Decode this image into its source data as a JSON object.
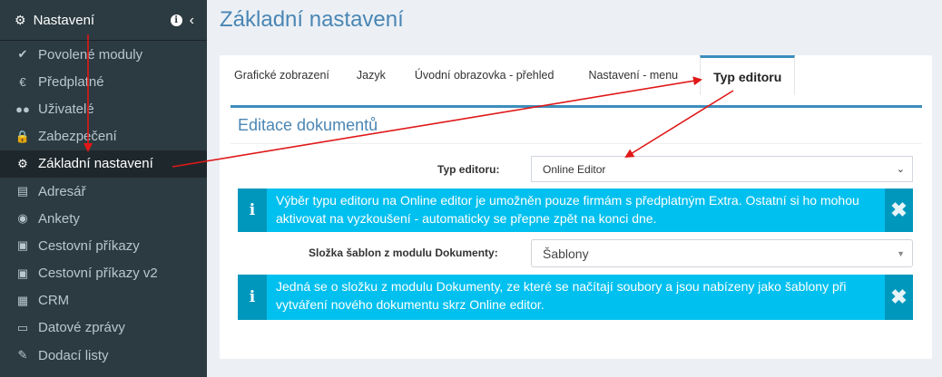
{
  "sidebar": {
    "header_label": "Nastavení",
    "info_symbol": "i",
    "collapse_symbol": "‹",
    "items": [
      {
        "label": "Povolené moduly",
        "icon": "✔",
        "icon_name": "check-icon"
      },
      {
        "label": "Předplatné",
        "icon": "€",
        "icon_name": "euro-icon"
      },
      {
        "label": "Uživatelé",
        "icon": "●●",
        "icon_name": "users-icon"
      },
      {
        "label": "Zabezpečení",
        "icon": "🔒",
        "icon_name": "lock-icon"
      },
      {
        "label": "Základní nastavení",
        "icon": "⚙",
        "icon_name": "cogs-icon",
        "active": true
      },
      {
        "label": "Adresář",
        "icon": "▤",
        "icon_name": "book-icon"
      },
      {
        "label": "Ankety",
        "icon": "◉",
        "icon_name": "bullseye-icon"
      },
      {
        "label": "Cestovní příkazy",
        "icon": "▣",
        "icon_name": "train-icon"
      },
      {
        "label": "Cestovní příkazy v2",
        "icon": "▣",
        "icon_name": "train-icon"
      },
      {
        "label": "CRM",
        "icon": "▦",
        "icon_name": "building-icon"
      },
      {
        "label": "Datové zprávy",
        "icon": "▭",
        "icon_name": "inbox-icon"
      },
      {
        "label": "Dodací listy",
        "icon": "✎",
        "icon_name": "edit-icon"
      }
    ]
  },
  "page": {
    "title": "Základní nastavení"
  },
  "tabs": [
    {
      "label": "Grafické zobrazení"
    },
    {
      "label": "Jazyk"
    },
    {
      "label": "Úvodní obrazovka - přehled"
    },
    {
      "label": "Nastavení - menu"
    },
    {
      "label": "Typ editoru",
      "active": true
    }
  ],
  "panel": {
    "title": "Editace dokumentů",
    "editor_label": "Typ editoru:",
    "editor_value": "Online Editor",
    "alert1_icon": "i",
    "alert1_text": "Výběr typu editoru na Online editor je umožněn pouze firmám s předplatným Extra. Ostatní si ho mohou aktivovat na vyzkoušení - automaticky se přepne zpět na konci dne.",
    "alert_close_symbol": "✖",
    "folder_label": "Složka šablon z modulu Dokumenty:",
    "folder_value": "Šablony",
    "alert2_icon": "i",
    "alert2_text": "Jedná se o složku z modulu Dokumenty, ze které se načítají soubory a jsou nabízeny jako šablony při vytváření nového dokumentu skrz Online editor."
  },
  "colors": {
    "sidebar_bg": "#2c3b41",
    "accent": "#3c8dbc",
    "alert_bg": "#00c0ef",
    "annotation_arrow": "#e01818"
  }
}
